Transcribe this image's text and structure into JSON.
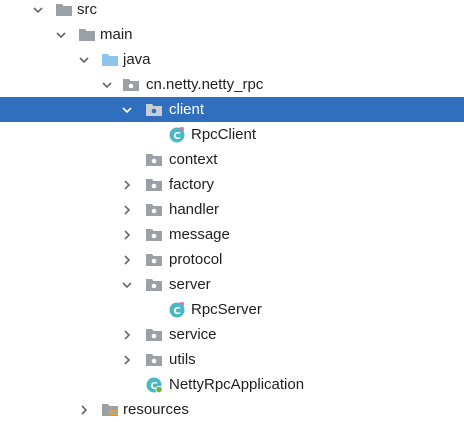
{
  "tree": {
    "rows": [
      {
        "label": "src",
        "icon": "folder-gray-icon",
        "expanded": true
      },
      {
        "label": "main",
        "icon": "folder-gray-icon",
        "expanded": true
      },
      {
        "label": "java",
        "icon": "folder-blue-icon",
        "expanded": true
      },
      {
        "label": "cn.netty.netty_rpc",
        "icon": "package-icon",
        "expanded": true
      },
      {
        "label": "client",
        "icon": "package-icon",
        "expanded": true,
        "selected": true
      },
      {
        "label": "RpcClient",
        "icon": "java-class-icon"
      },
      {
        "label": "context",
        "icon": "package-icon"
      },
      {
        "label": "factory",
        "icon": "package-icon",
        "expanded": false
      },
      {
        "label": "handler",
        "icon": "package-icon",
        "expanded": false
      },
      {
        "label": "message",
        "icon": "package-icon",
        "expanded": false
      },
      {
        "label": "protocol",
        "icon": "package-icon",
        "expanded": false
      },
      {
        "label": "server",
        "icon": "package-icon",
        "expanded": true
      },
      {
        "label": "RpcServer",
        "icon": "java-class-icon"
      },
      {
        "label": "service",
        "icon": "package-icon",
        "expanded": false
      },
      {
        "label": "utils",
        "icon": "package-icon",
        "expanded": false
      },
      {
        "label": "NettyRpcApplication",
        "icon": "spring-boot-class-icon"
      },
      {
        "label": "resources",
        "icon": "resources-folder-icon",
        "expanded": false
      }
    ]
  },
  "colors": {
    "selection": "#2f6fbd",
    "folder_gray": "#9aa0a6",
    "folder_blue": "#8fc5ea",
    "class_teal": "#4bb8c4"
  }
}
